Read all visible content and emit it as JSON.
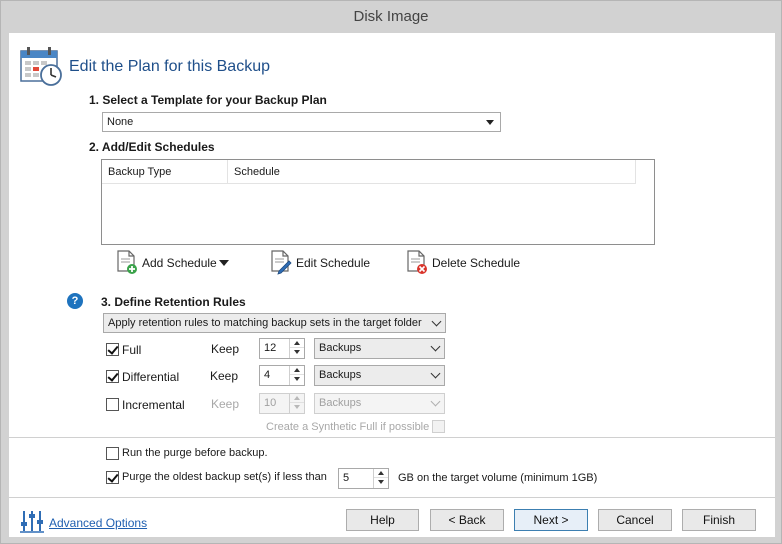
{
  "window": {
    "title": "Disk Image"
  },
  "header": {
    "title": "Edit the Plan for this Backup"
  },
  "template": {
    "heading": "1. Select a Template for your Backup Plan",
    "selected": "None"
  },
  "schedules": {
    "heading": "2. Add/Edit Schedules",
    "columns": [
      "Backup Type",
      "Schedule"
    ],
    "add_label": "Add Schedule",
    "edit_label": "Edit Schedule",
    "delete_label": "Delete Schedule"
  },
  "retention": {
    "heading": "3. Define Retention Rules",
    "rule_mode": "Apply retention rules to matching backup sets in the target folder",
    "rows": [
      {
        "label": "Full",
        "checked": true,
        "keep_label": "Keep",
        "value": "12",
        "unit": "Backups",
        "enabled": true
      },
      {
        "label": "Differential",
        "checked": true,
        "keep_label": "Keep",
        "value": "4",
        "unit": "Backups",
        "enabled": true
      },
      {
        "label": "Incremental",
        "checked": false,
        "keep_label": "Keep",
        "value": "10",
        "unit": "Backups",
        "enabled": false
      }
    ],
    "synthetic_label": "Create a Synthetic Full if possible"
  },
  "purge": {
    "run_before_label": "Run the purge before backup.",
    "oldest_label": "Purge the oldest backup set(s) if less than",
    "oldest_value": "5",
    "oldest_suffix": "GB on the target volume (minimum 1GB)"
  },
  "footer": {
    "advanced_label": "Advanced Options",
    "help": "Help",
    "back": "< Back",
    "next": "Next >",
    "cancel": "Cancel",
    "finish": "Finish"
  },
  "colors": {
    "accent": "#1f4f8a",
    "link": "#1f5fb0",
    "help_icon": "#1e73be",
    "delete_icon": "#d9342b",
    "add_icon": "#3aa24a"
  }
}
